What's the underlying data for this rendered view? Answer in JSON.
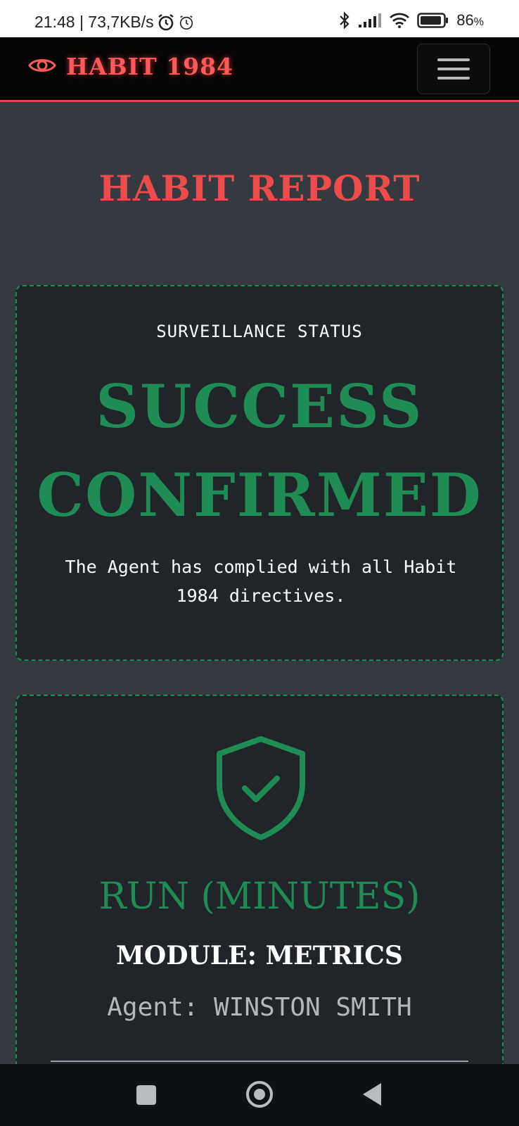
{
  "status_bar": {
    "time_speed": "21:48 | 73,7KB/s",
    "battery": "86",
    "battery_unit": "%"
  },
  "navbar": {
    "brand": "HABIT 1984",
    "brand_icon": "eye-icon",
    "menu_icon": "hamburger-icon"
  },
  "page": {
    "title": "HABIT REPORT"
  },
  "status_card": {
    "label": "SURVEILLANCE STATUS",
    "headline": "SUCCESS CONFIRMED",
    "description": "The Agent has complied with all Habit 1984 directives."
  },
  "module_card": {
    "icon": "shield-check-icon",
    "title": "RUN (MINUTES)",
    "subtitle": "MODULE: METRICS",
    "agent": "Agent: WINSTON SMITH"
  },
  "colors": {
    "accent_red": "#ee4b4b",
    "success_green": "#1e8c54",
    "card_bg": "#212529",
    "page_bg": "#343a40"
  }
}
